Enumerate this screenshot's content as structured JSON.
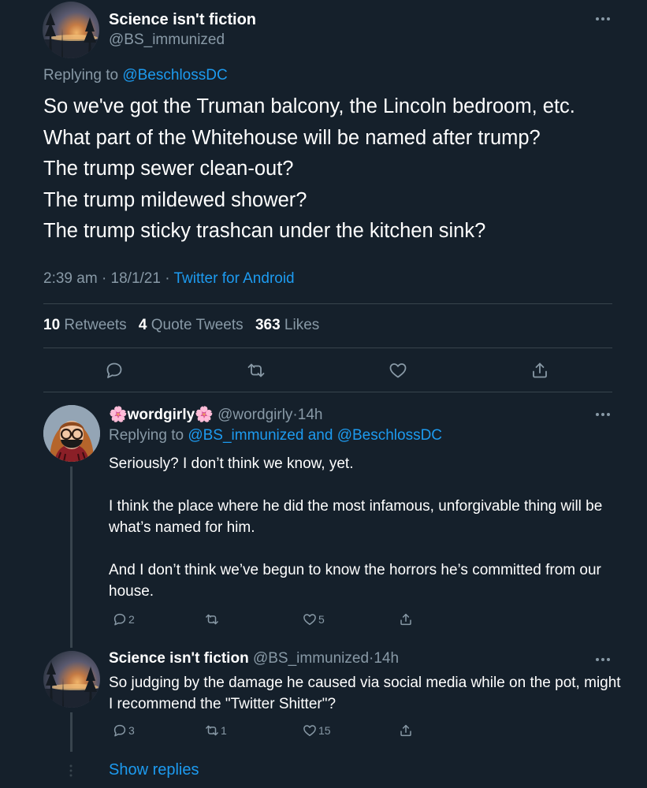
{
  "main_tweet": {
    "author_name": "Science isn't fiction",
    "author_handle": "@BS_immunized",
    "replying_prefix": "Replying to",
    "replying_to": "@BeschlossDC",
    "lines": [
      "So we've got the Truman balcony, the Lincoln bedroom, etc.",
      "What part of the Whitehouse will be named after trump?",
      "The trump sewer clean-out?",
      "The trump mildewed shower?",
      "The trump sticky trashcan under the kitchen sink?"
    ],
    "time": "2:39 am",
    "date": "18/1/21",
    "source": "Twitter for Android",
    "stats": {
      "retweets_count": "10",
      "retweets_label": "Retweets",
      "quotes_count": "4",
      "quotes_label": "Quote Tweets",
      "likes_count": "363",
      "likes_label": "Likes"
    }
  },
  "replies": [
    {
      "author_name": "🌸wordgirly🌸",
      "author_handle": "@wordgirly",
      "age": "14h",
      "replying_prefix": "Replying to",
      "replying_to_1": "@BS_immunized",
      "replying_and": "and",
      "replying_to_2": "@BeschlossDC",
      "paragraphs": [
        "Seriously? I don’t think we know, yet.",
        "I think the place where he did the most infamous, unforgivable thing will be what’s named for him.",
        "And I don’t think we’ve begun to know the horrors he’s committed from our house."
      ],
      "reply_count": "2",
      "retweet_count": "",
      "like_count": "5"
    },
    {
      "author_name": "Science isn't fiction",
      "author_handle": "@BS_immunized",
      "age": "14h",
      "paragraphs": [
        "So judging by the damage he caused via social media while on the pot, might I recommend the \"Twitter Shitter\"?"
      ],
      "reply_count": "3",
      "retweet_count": "1",
      "like_count": "15"
    }
  ],
  "show_replies": "Show replies",
  "colors": {
    "background": "#15202b",
    "muted": "#8899a6",
    "accent": "#1d9bf0",
    "divider": "#38444d"
  }
}
